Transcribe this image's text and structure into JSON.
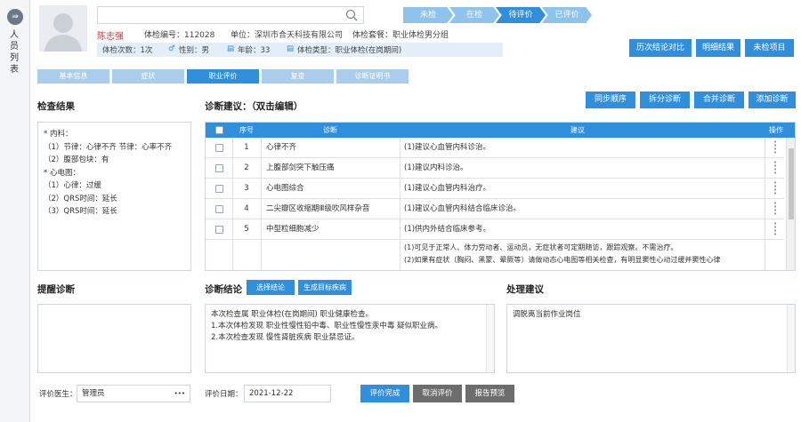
{
  "rail": {
    "menu_icon": "⇛",
    "label": "人员列表"
  },
  "search": {
    "placeholder": ""
  },
  "steps": [
    "未检",
    "在检",
    "待评价",
    "已评价"
  ],
  "patient": {
    "name": "陈志强",
    "exam_no": "体检编号：112028",
    "unit": "单位：深圳市合天科技有限公司",
    "package": "体检套餐：职业体检男分组",
    "visits": "体检次数：1次",
    "gender": "性别：男",
    "age": "年龄：33",
    "exam_type": "体检类型：职业体检(在岗期间)"
  },
  "header_buttons": [
    "历次结论对比",
    "明细结果",
    "未检项目"
  ],
  "tabs": [
    "基本信息",
    "症状",
    "职业评价",
    "复查",
    "诊断证明书"
  ],
  "check": {
    "title": "检查结果",
    "lines": [
      "* 内科：",
      "（1）节律：心律不齐 节律：心率不齐",
      "（2）腹部包块：有",
      "* 心电图：",
      "（1）心律：过缓",
      "（2）QRS时间：延长",
      "（3）QRS时间：延长"
    ]
  },
  "diag": {
    "title": "诊断建议：（双击编辑）",
    "buttons": [
      "同步顺序",
      "拆分诊断",
      "合并诊断",
      "添加诊断"
    ],
    "headers": [
      "序号",
      "诊断",
      "建议",
      "操作"
    ],
    "rows": [
      {
        "no": "1",
        "diag": "心律不齐",
        "advice": "(1)建议心血管内科诊治。"
      },
      {
        "no": "2",
        "diag": "上腹部剑突下触压痛",
        "advice": "(1)建议内科诊治。"
      },
      {
        "no": "3",
        "diag": "心电图综合",
        "advice": "(1)建议心血管内科治疗。"
      },
      {
        "no": "4",
        "diag": "二尖瓣区收缩期Ⅲ级吹风样杂音",
        "advice": "(1)建议心血管内科结合临床诊治。"
      },
      {
        "no": "5",
        "diag": "中型粒细胞减少",
        "advice": "(1)供内外结合临床参考。"
      }
    ],
    "extra_advice": [
      "(1)可见于正常人、体力劳动者、运动员，无症状者可定期随访，跟踪观察。不需治疗。",
      "(2)如果有症状（胸闷、黑蒙、晕厥等）请做动态心电图等相关检查，有明显窦性心动过缓并窦性心律"
    ]
  },
  "remind": {
    "title": "提醒诊断",
    "text": ""
  },
  "conclusion": {
    "title": "诊断结论",
    "btn_select": "选择结论",
    "btn_generate": "生成目标疾病",
    "lines": [
      "本次检查属 职业体检(在岗期间) 职业健康检查。",
      "1.本次体检发现 职业性慢性铅中毒、职业性慢性汞中毒 疑似职业病。",
      "2.本次检查发现 慢性肾脏疾病 职业禁忌证。"
    ]
  },
  "handling": {
    "title": "处理建议",
    "text": "调脱离当前作业岗位"
  },
  "footer": {
    "doctor_label": "评价医生：",
    "doctor_value": "管理员",
    "more_icon": "•••",
    "date_label": "评价日期：",
    "date_value": "2021-12-22",
    "btn_finish": "评价完成",
    "btn_cancel": "取消评价",
    "btn_preview": "报告预览"
  },
  "colors": {
    "primary": "#2f8fdc",
    "step_light": "#8ec3ec",
    "name_red": "#d9302c",
    "grey_btn": "#6d6d6d"
  }
}
